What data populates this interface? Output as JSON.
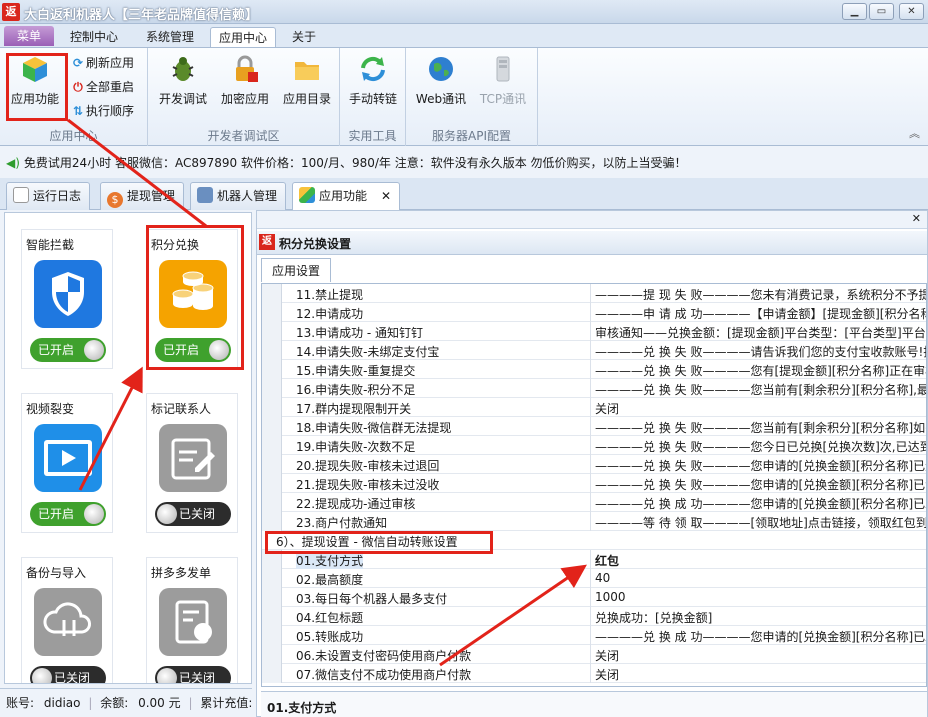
{
  "window": {
    "logo_char": "返",
    "title": "大白返利机器人【三年老品牌值得信赖】",
    "buttons": [
      "minimize",
      "restore",
      "close"
    ]
  },
  "ribbon_tabs": [
    {
      "label": "菜单",
      "active": false
    },
    {
      "label": "控制中心",
      "active": false
    },
    {
      "label": "系统管理",
      "active": false
    },
    {
      "label": "应用中心",
      "active": true
    },
    {
      "label": "关于",
      "active": false
    }
  ],
  "ribbon": {
    "groups": [
      {
        "label": "应用中心",
        "big": [
          "应用功能"
        ],
        "small": [
          "刷新应用",
          "全部重启",
          "执行顺序"
        ]
      },
      {
        "label": "开发者调试区",
        "big": [
          "开发调试",
          "加密应用",
          "应用目录"
        ]
      },
      {
        "label": "实用工具",
        "big": [
          "手动转链"
        ]
      },
      {
        "label": "服务器API配置",
        "big": [
          "Web通讯",
          "TCP通讯"
        ]
      }
    ]
  },
  "notice": "免费试用24小时 客服微信：AC897890 软件价格：100/月、980/年 注意：软件没有永久版本 勿低价购买，以防上当受骗！",
  "doc_tabs": [
    {
      "label": "运行日志",
      "icon": "log-icon"
    },
    {
      "label": "提现管理",
      "icon": "money-icon"
    },
    {
      "label": "机器人管理",
      "icon": "robot-icon"
    },
    {
      "label": "应用功能",
      "icon": "cube-icon",
      "active": true,
      "close": "✕"
    }
  ],
  "apps": [
    {
      "name": "智能拦截",
      "toggle": "已开启",
      "on": true,
      "icon": "shield-icon",
      "color": "#1f78e0"
    },
    {
      "name": "积分兑换",
      "toggle": "已开启",
      "on": true,
      "icon": "coins-icon",
      "color": "#f5a300"
    },
    {
      "name": "视频裂变",
      "toggle": "已开启",
      "on": true,
      "icon": "video-icon",
      "color": "#1f8fe8"
    },
    {
      "name": "标记联系人",
      "toggle": "已关闭",
      "on": false,
      "icon": "edit-note-icon",
      "color": "#9c9c9c"
    },
    {
      "name": "备份与导入",
      "toggle": "已关闭",
      "on": false,
      "icon": "cloud-icon",
      "color": "#9c9c9c"
    },
    {
      "name": "拼多多发单",
      "toggle": "已关闭",
      "on": false,
      "icon": "pdd-icon",
      "color": "#9c9c9c"
    }
  ],
  "status": {
    "account_label": "账号:",
    "account": "didiao",
    "balance_label": "余额:",
    "balance": "0.00 元",
    "recharge_label": "累计充值:"
  },
  "settings": {
    "header_icon": "返",
    "title": "积分兑换设置",
    "subtab": "应用设置",
    "rows": [
      {
        "k": "11.禁止提现",
        "v": "————提 现 失 败————您未有消费记录，系统积分不予提现"
      },
      {
        "k": "12.申请成功",
        "v": "————申 请 成 功————【申请金额】[提现金额][积分名称]"
      },
      {
        "k": "13.申请成功 - 通知钉钉",
        "v": "审核通知——兑换金额：[提现金额]平台类型：[平台类型]平台账"
      },
      {
        "k": "14.申请失败-未绑定支付宝",
        "v": "————兑 换 失 败————请告诉我们您的支付宝收款账号!指"
      },
      {
        "k": "15.申请失败-重复提交",
        "v": "————兑 换 失 败————您有[提现金额][积分名称]正在审核"
      },
      {
        "k": "16.申请失败-积分不足",
        "v": "————兑 换 失 败————您当前有[剩余积分][积分名称],最低"
      },
      {
        "k": "17.群内提现限制开关",
        "v": "关闭"
      },
      {
        "k": "18.申请失败-微信群无法提现",
        "v": "————兑 换 失 败————您当前有[剩余积分][积分名称]如需兑"
      },
      {
        "k": "19.申请失败-次数不足",
        "v": "————兑 换 失 败————您今日已兑换[兑换次数]次,已达到上"
      },
      {
        "k": "20.提现失败-审核未过退回",
        "v": "————兑 换 失 败————您申请的[兑换金额][积分名称]已退回"
      },
      {
        "k": "21.提现失败-审核未过没收",
        "v": "————兑 换 失 败————您申请的[兑换金额][积分名称]已没收"
      },
      {
        "k": "22.提现成功-通过审核",
        "v": "————兑 换 成 功————您申请的[兑换金额][积分名称]已发放"
      },
      {
        "k": "23.商户付款通知",
        "v": "————等 待 领 取————[领取地址]点击链接，领取红包到您"
      }
    ],
    "section": "6）、提现设置 - 微信自动转账设置",
    "rows2": [
      {
        "k": "01.支付方式",
        "v": "红包",
        "selected": true
      },
      {
        "k": "02.最高额度",
        "v": "40"
      },
      {
        "k": "03.每日每个机器人最多支付",
        "v": "1000"
      },
      {
        "k": "04.红包标题",
        "v": "兑换成功：[兑换金额]"
      },
      {
        "k": "05.转账成功",
        "v": "————兑 换 成 功————您申请的[兑换金额][积分名称]已发放"
      },
      {
        "k": "06.未设置支付密码使用商户付款",
        "v": "关闭"
      },
      {
        "k": "07.微信支付不成功使用商户付款",
        "v": "关闭"
      }
    ],
    "description_title": "01.支付方式"
  },
  "colors": {
    "highlight": "#e2231a",
    "accent": "#3fa12d"
  }
}
